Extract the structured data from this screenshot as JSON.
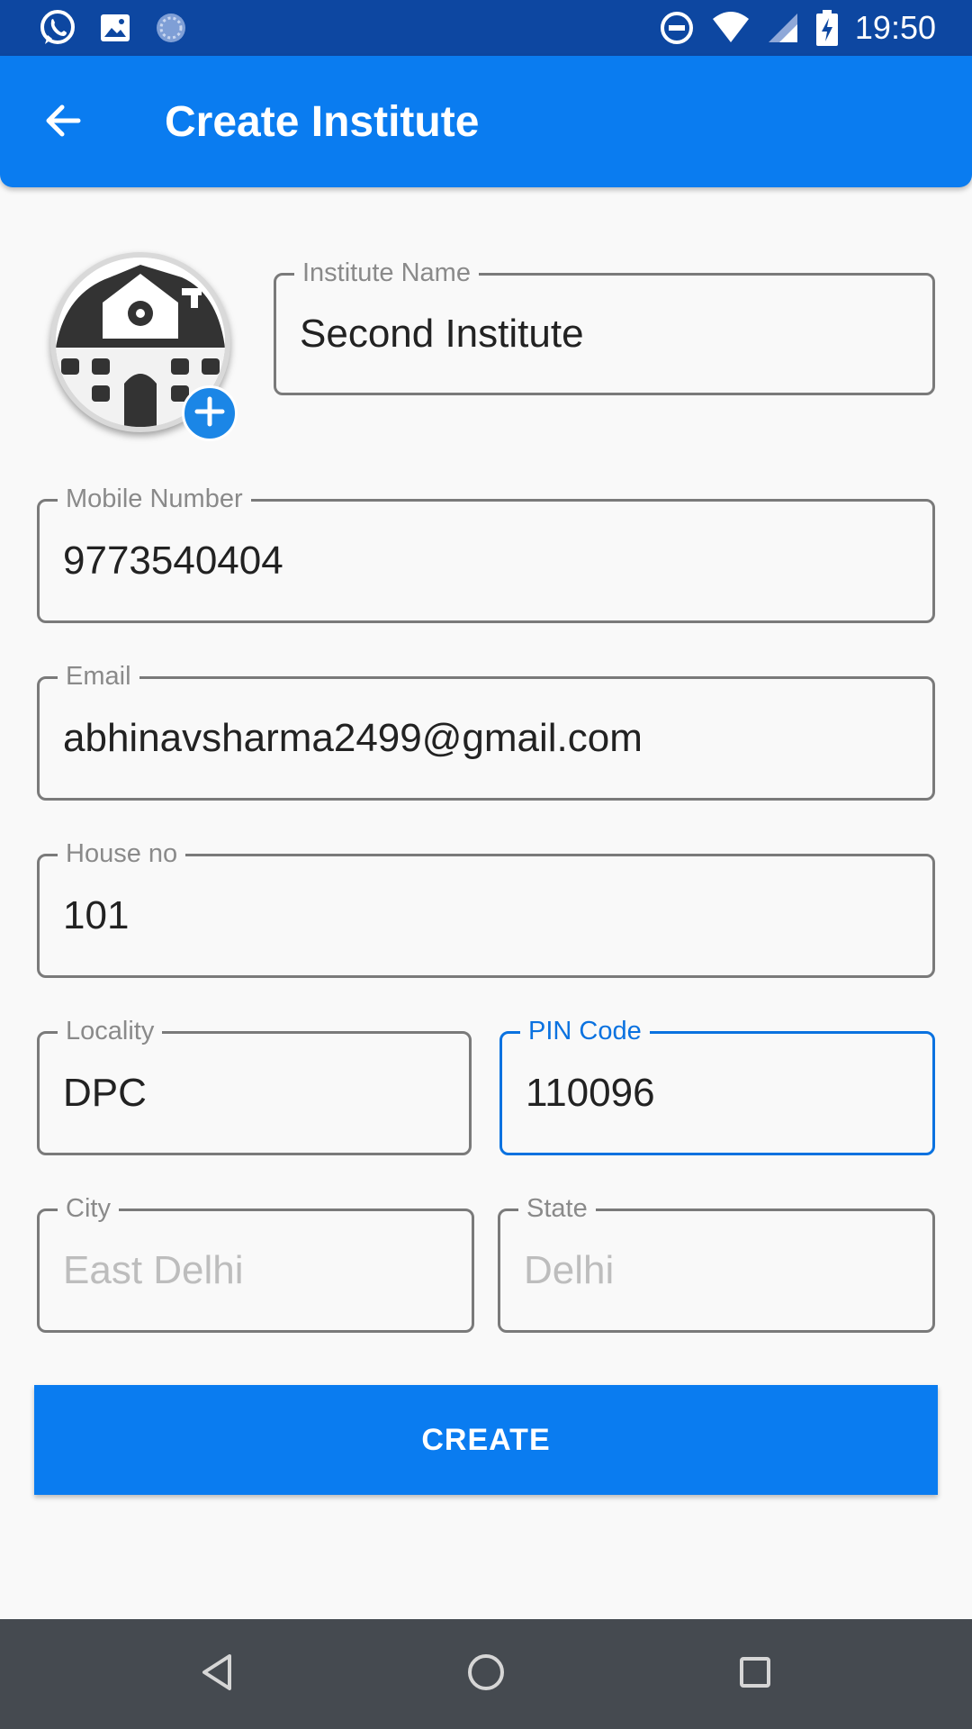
{
  "status_bar": {
    "time": "19:50",
    "icons_left": [
      "whatsapp-icon",
      "gallery-icon",
      "app-icon"
    ],
    "icons_right": [
      "do-not-disturb-icon",
      "wifi-icon",
      "signal-icon",
      "battery-charging-icon"
    ]
  },
  "app_bar": {
    "title": "Create Institute",
    "back_icon": "arrow-back-icon"
  },
  "logo": {
    "add_icon": "add-circle-icon"
  },
  "form": {
    "institute_name": {
      "label": "Institute Name",
      "value": "Second Institute"
    },
    "mobile_number": {
      "label": "Mobile Number",
      "value": "9773540404"
    },
    "email": {
      "label": "Email",
      "value": "abhinavsharma2499@gmail.com"
    },
    "house_no": {
      "label": "House no",
      "value": "101"
    },
    "locality": {
      "label": "Locality",
      "value": "DPC"
    },
    "pin_code": {
      "label": "PIN Code",
      "value": "110096"
    },
    "city": {
      "label": "City",
      "value": "East Delhi"
    },
    "state": {
      "label": "State",
      "value": "Delhi"
    }
  },
  "create_button": {
    "label": "CREATE"
  },
  "colors": {
    "primary": "#0a7cf0",
    "status_bar": "#0d47a1",
    "focus": "#0a72e0",
    "nav_bar": "#454a50"
  },
  "nav_bar": {
    "icons": [
      "back-triangle-icon",
      "home-circle-icon",
      "recents-square-icon"
    ]
  }
}
